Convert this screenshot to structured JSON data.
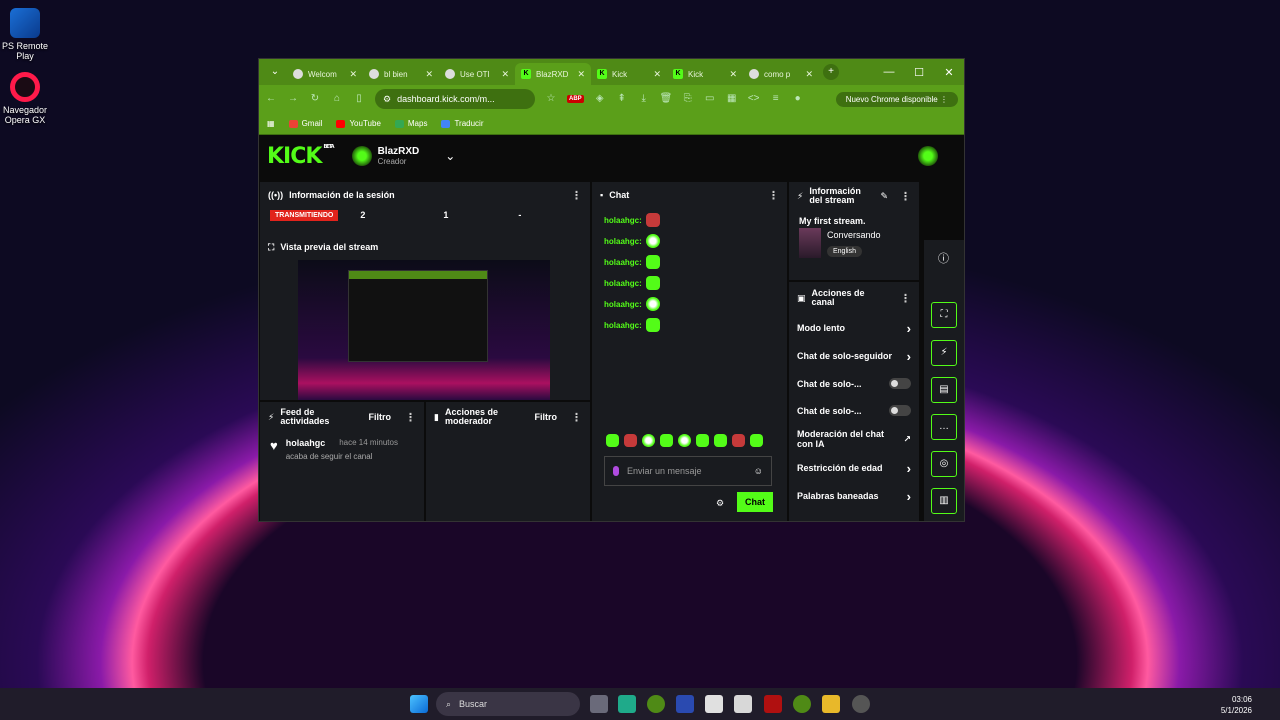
{
  "desktop": {
    "icons": [
      {
        "label": "PS Remote Play"
      },
      {
        "label": "Navegador Opera GX"
      }
    ]
  },
  "browser": {
    "tabs": [
      {
        "title": "Welcom"
      },
      {
        "title": "bl bien"
      },
      {
        "title": "Use OTI"
      },
      {
        "title": "BlazRXD"
      },
      {
        "title": "Kick"
      },
      {
        "title": "Kick"
      },
      {
        "title": "como p"
      }
    ],
    "url": "dashboard.kick.com/m...",
    "update_label": "Nuevo Chrome disponible",
    "bookmarks": [
      {
        "label": "Gmail",
        "color": "#ea4335"
      },
      {
        "label": "YouTube",
        "color": "#ff0000"
      },
      {
        "label": "Maps",
        "color": "#34a853"
      },
      {
        "label": "Traducir",
        "color": "#4285f4"
      }
    ]
  },
  "kick": {
    "logo": "KICK",
    "beta": "BETA",
    "user": {
      "name": "BlazRXD",
      "role": "Creador"
    },
    "session": {
      "title": "Información de la sesión",
      "status": "TRANSMITIENDO",
      "stat1": "2",
      "stat2": "1",
      "stat3": "-"
    },
    "preview_title": "Vista previa del stream",
    "feed": {
      "title": "Feed de actividades",
      "filter": "Filtro",
      "item": {
        "user": "holaahgc",
        "time": "hace 14 minutos",
        "action": "acaba de seguir el canal"
      }
    },
    "mod": {
      "title": "Acciones de moderador",
      "filter": "Filtro"
    },
    "chat": {
      "title": "Chat",
      "messages": [
        {
          "user": "holaahgc:"
        },
        {
          "user": "holaahgc:"
        },
        {
          "user": "holaahgc:"
        },
        {
          "user": "holaahgc:"
        },
        {
          "user": "holaahgc:"
        },
        {
          "user": "holaahgc:"
        }
      ],
      "placeholder": "Enviar un mensaje",
      "send_label": "Chat"
    },
    "stream_info": {
      "title": "Información del stream",
      "stream_title": "My first stream.",
      "category": "Conversando",
      "language": "English"
    },
    "channel_actions": {
      "title": "Acciones de canal",
      "rows": [
        {
          "label": "Modo lento"
        },
        {
          "label": "Chat de solo-seguidor"
        },
        {
          "label": "Chat de solo-..."
        },
        {
          "label": "Chat de solo-..."
        },
        {
          "label": "Moderación del chat con IA"
        },
        {
          "label": "Restricción de edad"
        },
        {
          "label": "Palabras baneadas"
        }
      ]
    }
  },
  "taskbar": {
    "search": "Buscar",
    "time": "03:06",
    "date": "5/1/2026"
  }
}
